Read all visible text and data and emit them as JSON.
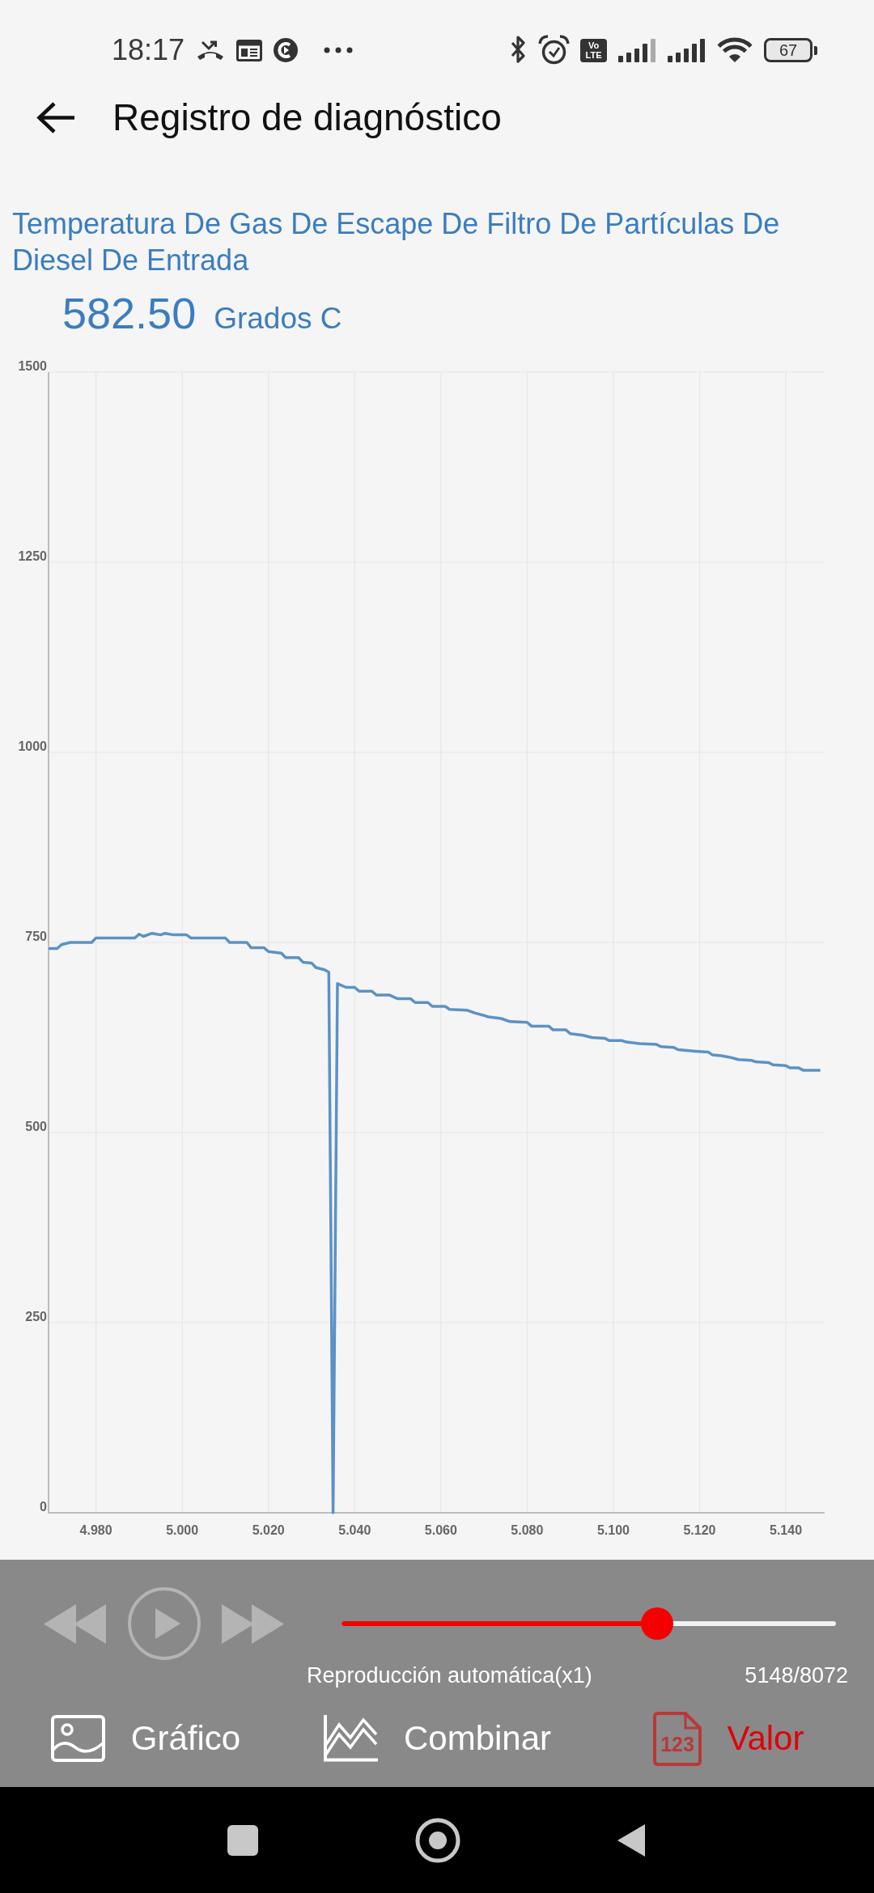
{
  "status_bar": {
    "time": "18:17",
    "network_badge": "Vo LTE",
    "battery": "67"
  },
  "header": {
    "title": "Registro de diagnóstico"
  },
  "parameter": {
    "name": "Temperatura De Gas De Escape De Filtro De Partículas De Diesel De Entrada",
    "value": "582.50",
    "unit": "Grados C",
    "chart_data": {
      "type": "line",
      "grid": true,
      "x": [
        4.969,
        4.971,
        4.972,
        4.974,
        4.979,
        4.98,
        4.989,
        4.99,
        4.991,
        4.993,
        4.995,
        4.996,
        4.998,
        5.001,
        5.002,
        5.01,
        5.011,
        5.015,
        5.016,
        5.019,
        5.02,
        5.023,
        5.024,
        5.027,
        5.028,
        5.03,
        5.031,
        5.033,
        5.034,
        5.035,
        5.036,
        5.038,
        5.04,
        5.041,
        5.044,
        5.045,
        5.048,
        5.05,
        5.053,
        5.054,
        5.057,
        5.058,
        5.061,
        5.062,
        5.066,
        5.068,
        5.07,
        5.071,
        5.074,
        5.076,
        5.08,
        5.081,
        5.085,
        5.086,
        5.089,
        5.09,
        5.093,
        5.095,
        5.098,
        5.099,
        5.102,
        5.103,
        5.106,
        5.11,
        5.111,
        5.114,
        5.115,
        5.117,
        5.119,
        5.122,
        5.123,
        5.125,
        5.127,
        5.129,
        5.132,
        5.133,
        5.136,
        5.137,
        5.14,
        5.141,
        5.143,
        5.144,
        5.148
      ],
      "series": [
        {
          "color": "#5b92c5",
          "values": [
            742,
            742,
            747,
            750,
            750,
            756,
            756,
            761,
            758,
            762,
            760,
            762,
            760,
            760,
            756,
            756,
            750,
            750,
            743,
            743,
            738,
            736,
            730,
            730,
            724,
            723,
            717,
            714,
            711,
            0,
            696,
            691,
            691,
            686,
            686,
            681,
            681,
            676,
            676,
            671,
            671,
            666,
            666,
            662,
            661,
            657,
            654,
            652,
            650,
            646,
            645,
            640,
            640,
            635,
            635,
            630,
            628,
            625,
            624,
            621,
            621,
            619,
            617,
            616,
            613,
            612,
            609,
            608,
            607,
            606,
            602,
            601,
            599,
            596,
            595,
            593,
            592,
            589,
            588,
            585,
            585,
            582,
            582
          ]
        }
      ],
      "xlim": [
        4.969,
        5.149
      ],
      "ylim": [
        0,
        1500
      ],
      "xticks": [
        {
          "value": 4.98,
          "label": "4.980"
        },
        {
          "value": 5.0,
          "label": "5.000"
        },
        {
          "value": 5.02,
          "label": "5.020"
        },
        {
          "value": 5.04,
          "label": "5.040"
        },
        {
          "value": 5.06,
          "label": "5.060"
        },
        {
          "value": 5.08,
          "label": "5.080"
        },
        {
          "value": 5.1,
          "label": "5.100"
        },
        {
          "value": 5.12,
          "label": "5.120"
        },
        {
          "value": 5.14,
          "label": "5.140"
        }
      ],
      "yticks": [
        0,
        250,
        500,
        750,
        1000,
        1250,
        1500
      ]
    }
  },
  "playback": {
    "slider": {
      "level": 0.638
    },
    "mode": "Reproducción automática(x1)",
    "position": "5148/8072"
  },
  "tabs": [
    {
      "kind": "picture",
      "label": "Gráfico",
      "selected": false
    },
    {
      "kind": "lines",
      "label": "Combinar",
      "selected": false
    },
    {
      "kind": "number",
      "label": "Valor",
      "icon_text": "123",
      "selected": true
    }
  ]
}
